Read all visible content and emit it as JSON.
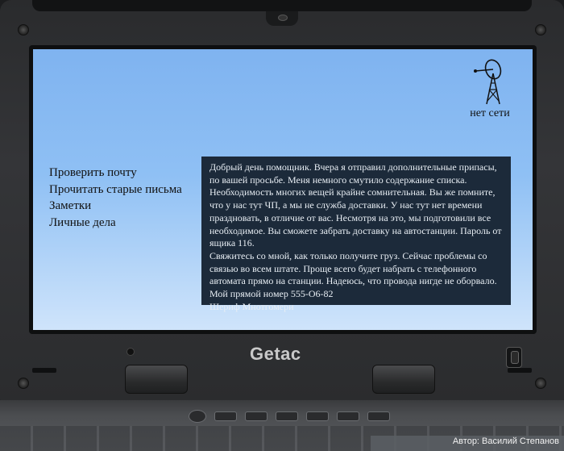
{
  "screen": {
    "menu": {
      "items": [
        {
          "label": "Проверить почту"
        },
        {
          "label": "Прочитать старые письма"
        },
        {
          "label": "Заметки"
        },
        {
          "label": "Личные дела"
        }
      ]
    },
    "network": {
      "status_label": "нет сети",
      "icon": "antenna-tower-icon"
    },
    "message": {
      "paragraphs": [
        "Добрый день помощник. Вчера я отправил дополнительные припасы, по вашей просьбе. Меня немного смутило содержание списка. Необходимость многих вещей крайне сомнительная. Вы же помните, что у нас тут ЧП, а мы не служба доставки. У нас тут нет времени праздновать, в отличие от вас. Несмотря на это, мы подготовили все необходимое. Вы сможете забрать доставку на автостанции. Пароль от ящика 116.",
        "Свяжитесь со мной, как только получите груз. Сейчас проблемы со связью во всем штате. Проще всего будет набрать с телефонного автомата прямо на станции. Надеюсь, что провода нигде не оборвало. Мой прямой номер 555-О6-82",
        "Шериф Мнотгомери"
      ]
    }
  },
  "device": {
    "brand": "Getac"
  },
  "credit": "Автор: Василий Степанов",
  "colors": {
    "screen_top": "#7fb3f0",
    "screen_bottom": "#cfe4fb",
    "message_bg": "#1c2a3a",
    "message_text": "#e8eef4"
  }
}
